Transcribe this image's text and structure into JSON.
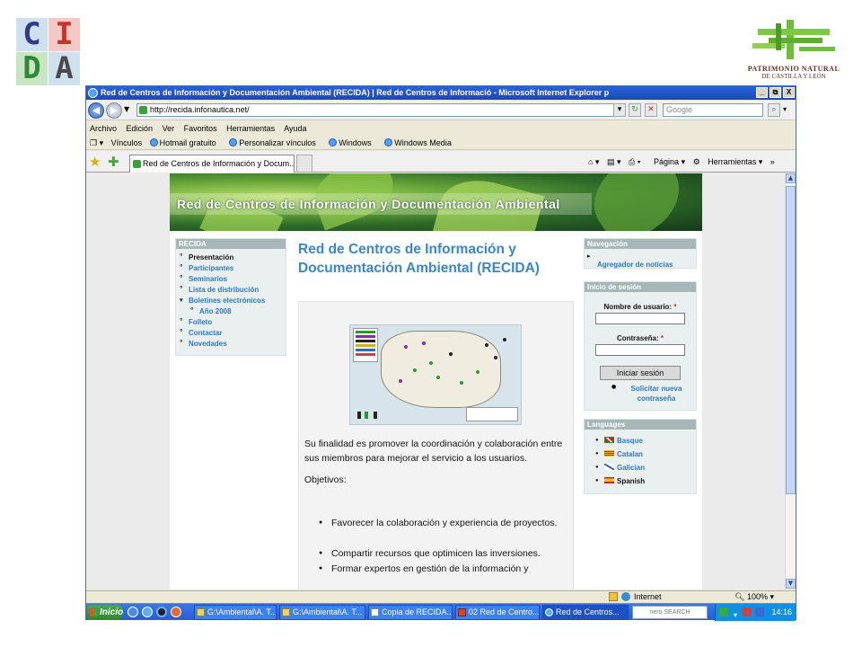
{
  "slide": {
    "left_logo": [
      "C",
      "I",
      "D",
      "A"
    ],
    "right_logo": {
      "line1": "PATRIMONIO NATURAL",
      "line2": "DE CASTILLA Y LEÓN"
    }
  },
  "window": {
    "title": "Red de Centros de Información y Documentación Ambiental (RECIDA) | Red de Centros de Informació - Microsoft Internet Explorer p",
    "buttons": [
      "_",
      "⧉",
      "X"
    ],
    "url": "http://recida.infonautica.net/",
    "search_placeholder": "Google",
    "menu": [
      "Archivo",
      "Edición",
      "Ver",
      "Favoritos",
      "Herramientas",
      "Ayuda"
    ],
    "links": [
      "Vínculos",
      "Hotmail gratuito",
      "Personalizar vínculos",
      "Windows",
      "Windows Media"
    ],
    "tab_label": "Red de Centros de Información y Docum...",
    "command_bar": [
      "Página",
      "Herramientas"
    ],
    "status": {
      "zone": "Internet",
      "zoom": "100%"
    }
  },
  "site": {
    "banner": "Red de Centros de Información y Documentación Ambiental",
    "left_box": {
      "heading": "RECIDA",
      "items": [
        "Presentación",
        "Participantes",
        "Seminarios",
        "Lista de distribución",
        "Boletines electrónicos",
        "Año 2008",
        "Folleto",
        "Contactar",
        "Novedades"
      ]
    },
    "page_title": "Red de Centros de Información y Documentación Ambiental (RECIDA)",
    "paragraph": "Su finalidad es promover la coordinación y colaboración entre sus miembros para mejorar el servicio a los usuarios.",
    "objectives_label": "Objetivos:",
    "objectives": [
      "Favorecer la colaboración y experiencia de proyectos.",
      "Compartir recursos que optimicen las inversiones.",
      "Formar expertos en gestión de la información y"
    ],
    "nav_box": {
      "heading": "Navegación",
      "link": "Agregador de noticias"
    },
    "login_box": {
      "heading": "Inicio de sesión",
      "user_label": "Nombre de usuario:",
      "pass_label": "Contraseña:",
      "required_mark": "*",
      "button": "Iniciar sesión",
      "new_pass_link": "Solicitar nueva contraseña"
    },
    "lang_box": {
      "heading": "Languages",
      "items": [
        "Basque",
        "Catalan",
        "Galician",
        "Spanish"
      ]
    }
  },
  "taskbar": {
    "start": "Inicio",
    "buttons": [
      "G:\\Ambiental\\A. T...",
      "G:\\Ambiental\\A. T...",
      "Copia de RECIDA...",
      "02 Red de Centro...",
      "Red de Centros..."
    ],
    "nero": "nero SEARCH",
    "clock": "14:16"
  }
}
